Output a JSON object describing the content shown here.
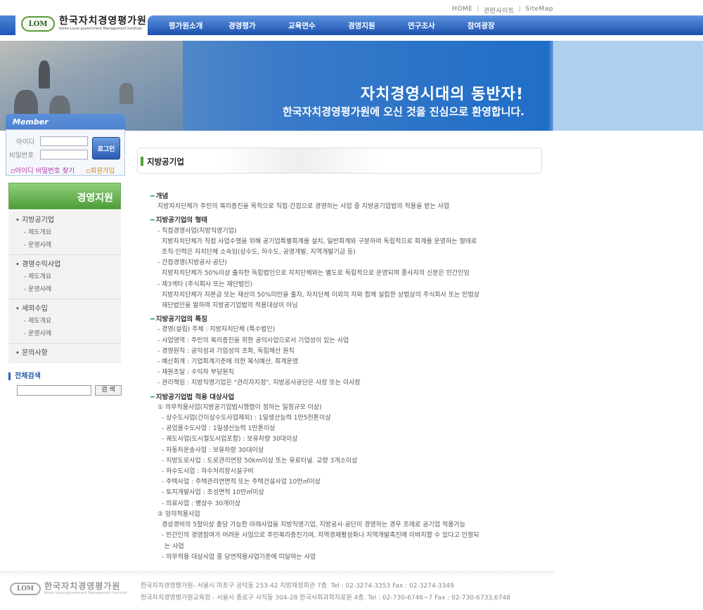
{
  "util": {
    "home": "HOME",
    "related": "관련사이트",
    "sitemap": "SiteMap",
    "sep": "|"
  },
  "logo": {
    "mark": "LOM",
    "kr": "한국자치경영평가원",
    "en": "Korea Local-government Management Institute"
  },
  "gnb": [
    "평가원소개",
    "경영평가",
    "교육연수",
    "경영지원",
    "연구조사",
    "참여광장"
  ],
  "banner": {
    "line1": "자치경영시대의 동반자!",
    "line2": "한국자치경영평가원에 오신 것을 진심으로 환영합니다."
  },
  "member": {
    "title": "Member",
    "id_label": "아이디",
    "pw_label": "비밀번호",
    "login": "로그인",
    "find": "아이디 비밀번호 찾기",
    "join": "회원가입"
  },
  "side": {
    "title": "경영지원",
    "menu": [
      {
        "label": "지방공기업",
        "subs": [
          "제도개요",
          "운영사례"
        ]
      },
      {
        "label": "경영수익사업",
        "subs": [
          "제도개요",
          "운영사례"
        ]
      },
      {
        "label": "세외수입",
        "subs": [
          "제도개요",
          "운영사례"
        ]
      },
      {
        "label": "문의사항",
        "subs": []
      }
    ],
    "search_title": "전체검색",
    "search_btn": "검 색"
  },
  "page_title": "지방공기업",
  "content": [
    {
      "h": "개념",
      "lines": [
        {
          "c": "p1",
          "t": "지방자치단체가 주민의 복리증진을 목적으로 직접·간접으로 경영하는 사업 중 지방공기업법의 적용을 받는 사업"
        }
      ]
    },
    {
      "h": "지방공기업의 형태",
      "lines": [
        {
          "c": "p1",
          "t": "- 직접경영사업(지방직영기업)"
        },
        {
          "c": "p2",
          "t": "지방자치단체가 직접 사업수행을 위해 공기업특별회계를 설치, 일반회계와 구분하여 독립적으로 회계를 운영하는 형태로"
        },
        {
          "c": "p2",
          "t": "조직·인력은 자치단체 소속임(상수도, 하수도, 공영개발, 지역개발기금 등)"
        },
        {
          "c": "p1",
          "t": "- 간접경영(지방공사·공단)"
        },
        {
          "c": "p2",
          "t": "지방자치단체가 50%이상 출자한 독립법인으로 자치단체와는 별도로 독립적으로 운영되며 종사자의 신분은 민간인임"
        },
        {
          "c": "p1",
          "t": "- 제3섹타 (주식회사 또는 재단법인)"
        },
        {
          "c": "p2",
          "t": "지방자치단체가 자본금 또는 재산의 50%미만을 출자, 자치단체 이외의 자와 합께 설립한 상법상의 주식회사 또는 민법상"
        },
        {
          "c": "p2",
          "t": "재단법인을 말하며 지방공기업법의 적용대상이 아님"
        }
      ]
    },
    {
      "h": "지방공기업의 특징",
      "lines": [
        {
          "c": "p1",
          "t": "- 경영(설립) 주체 : 지방자치단체 (특수법인)"
        },
        {
          "c": "p1",
          "t": "- 사업영역 : 주민의 복리증진을 위한 공익사업으로서 기업성이 있는 사업"
        },
        {
          "c": "p1",
          "t": "- 경영원칙 : 공익성과 기업성의 조화, 독립채산 원칙"
        },
        {
          "c": "p1",
          "t": "- 예산회계 : 기업회계기준에 의한 복식예산, 회계운영"
        },
        {
          "c": "p1",
          "t": "- 재원조달 : 수익자 부담원칙"
        },
        {
          "c": "p1",
          "t": "- 관리책임 : 지방직영기업은 \"관리자지정\", 지방공사공단은 사장 또는 이사장"
        }
      ]
    },
    {
      "h": "지방공기업법 적용 대상사업",
      "lines": [
        {
          "c": "p1",
          "t": "① 의무적용사업(지방공기업법시행령이 정하는 일정규모 이상)"
        },
        {
          "c": "p2",
          "t": "- 상수도사업(간이상수도사업제외) : 1일생산능력 1만5천톤이상"
        },
        {
          "c": "p2",
          "t": "- 공업용수도사업 : 1일생산능력 1만톤이상"
        },
        {
          "c": "p2",
          "t": "- 궤도사업(도시철도사업포함) : 보유차량 30대이상"
        },
        {
          "c": "p2",
          "t": "- 자동차운송사업 : 보유차량 30대이상"
        },
        {
          "c": "p2",
          "t": "- 지방도로사업 : 도로관리연장 50km이상 또는 유료터널. 교량 3개소이상"
        },
        {
          "c": "p2",
          "t": "- 하수도사업 : 하수처리장시설구비"
        },
        {
          "c": "p2",
          "t": "- 주택사업 : 주택관리연면적 또는 주택건설사업 10만㎡이상"
        },
        {
          "c": "p2",
          "t": "- 토지개발사업 : 조성면적 10만㎡이상"
        },
        {
          "c": "p2",
          "t": "- 의료사업 : 병상수 30개이상"
        },
        {
          "c": "p1",
          "t": "② 임의적용사업"
        },
        {
          "c": "p2",
          "t": "경상경비의 5할이상 충당 가능한 아래사업을 지방직영기업, 지방공사·공단이 경영하는 경우 조례로 공기업 적용가능"
        },
        {
          "c": "p2",
          "t": "- 민간인의 경영참여가 어려운 사업으로 주민복리증진기여, 지역경제활성화나 지역개발촉진에 이바지할 수 있다고 인정되"
        },
        {
          "c": "p3",
          "t": "는 사업"
        },
        {
          "c": "p2",
          "t": "- 의무적용 대상사업 중 당연적용사업기준에 미달하는 사업"
        }
      ]
    }
  ],
  "footer": {
    "logo_kr": "한국자치경영평가원",
    "logo_en": "Korea Local-government Management Institute",
    "addr1": "한국자치경영평가원- 서울시 마포구 공덕동 253-42 지방재정회관 7층. Tel : 02-3274-3353   Fax : 02-3274-3349",
    "addr2": "한국자치경영평가원교육장 - 서울시 종로구 사직동 304-28 한국사회과학자료원 4층. Tel : 02-730-6746~7   Fax : 02-730-6733,6748"
  }
}
